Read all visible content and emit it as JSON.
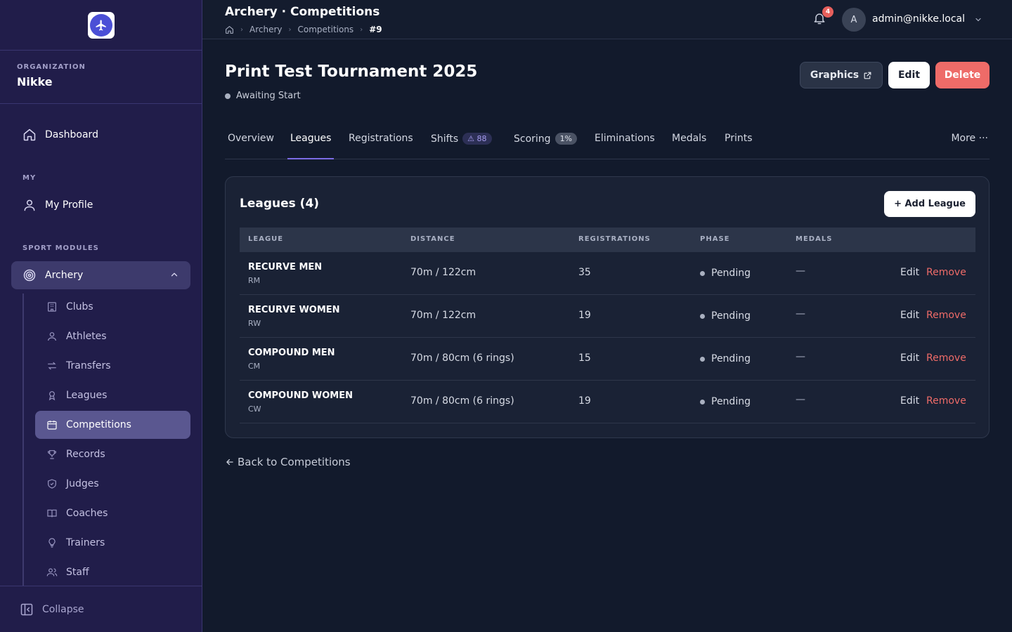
{
  "sidebar": {
    "logo_alt": "app-logo",
    "org_label": "ORGANIZATION",
    "org_name": "Nikke",
    "dashboard": "Dashboard",
    "my_label": "MY",
    "my_profile": "My Profile",
    "sport_modules_label": "SPORT MODULES",
    "archery": "Archery",
    "sub_items": [
      "Clubs",
      "Athletes",
      "Transfers",
      "Leagues",
      "Competitions",
      "Records",
      "Judges",
      "Coaches",
      "Trainers",
      "Staff"
    ],
    "active_sub_item": "Competitions",
    "collapse": "Collapse"
  },
  "topbar": {
    "title": "Archery · Competitions",
    "breadcrumb": [
      "Archery",
      "Competitions",
      "#9"
    ],
    "notification_count": "4",
    "avatar_initial": "A",
    "user_email": "admin@nikke.local"
  },
  "competition": {
    "title": "Print Test Tournament 2025",
    "status": "Awaiting Start",
    "buttons": {
      "graphics": "Graphics",
      "edit": "Edit",
      "delete": "Delete"
    }
  },
  "tabs": {
    "items": [
      {
        "label": "Overview"
      },
      {
        "label": "Leagues",
        "active": true
      },
      {
        "label": "Registrations"
      },
      {
        "label": "Shifts",
        "badge": "88",
        "badge_icon": "warning-icon"
      },
      {
        "label": "Scoring",
        "badge": "1%"
      },
      {
        "label": "Eliminations"
      },
      {
        "label": "Medals"
      },
      {
        "label": "Prints"
      }
    ],
    "more": "More"
  },
  "leagues": {
    "title": "Leagues (4)",
    "add_button": "+ Add League",
    "columns": [
      "LEAGUE",
      "DISTANCE",
      "REGISTRATIONS",
      "PHASE",
      "MEDALS"
    ],
    "rows": [
      {
        "name": "RECURVE MEN",
        "code": "RM",
        "distance": "70m / 122cm",
        "registrations": "35",
        "phase": "Pending",
        "medals": "—"
      },
      {
        "name": "RECURVE WOMEN",
        "code": "RW",
        "distance": "70m / 122cm",
        "registrations": "19",
        "phase": "Pending",
        "medals": "—"
      },
      {
        "name": "COMPOUND MEN",
        "code": "CM",
        "distance": "70m / 80cm (6 rings)",
        "registrations": "15",
        "phase": "Pending",
        "medals": "—"
      },
      {
        "name": "COMPOUND WOMEN",
        "code": "CW",
        "distance": "70m / 80cm (6 rings)",
        "registrations": "19",
        "phase": "Pending",
        "medals": "—"
      }
    ],
    "row_actions": {
      "edit": "Edit",
      "remove": "Remove"
    }
  },
  "back_link": "Back to Competitions",
  "colors": {
    "sidebar_bg": "#211d4a",
    "page_bg": "#121a2c",
    "accent": "#7b6ce4",
    "danger": "#ee6b68"
  }
}
